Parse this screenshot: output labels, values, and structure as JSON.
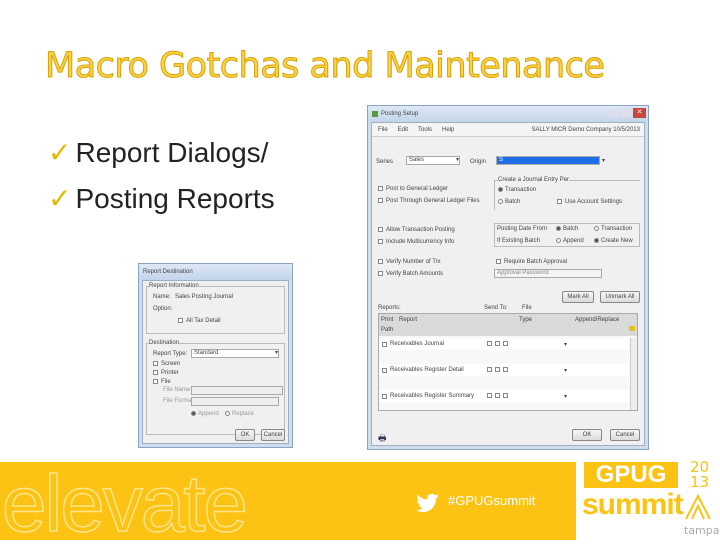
{
  "slide": {
    "title": "Macro Gotchas and Maintenance",
    "bullets": [
      "Report Dialogs/",
      "Posting Reports"
    ],
    "hashtag": "#GPUGsummit",
    "brand_word": "elevate",
    "logo": {
      "line1": "GPUG",
      "line2": "summit",
      "year_top": "20",
      "year_bottom": "13",
      "city": "tampa"
    }
  },
  "posting_setup": {
    "title": "Posting Setup",
    "menu": [
      "File",
      "Edit",
      "Tools",
      "Help"
    ],
    "company": "SALLY  MICR Demo Company  10/5/2013",
    "series_label": "Series",
    "series_value": "Sales",
    "origin_label": "Origin",
    "origin_value": "S",
    "checks": [
      "Post to General Ledger",
      "Post Through General Ledger Files",
      "Allow Transaction Posting",
      "Include Multicurrency Info",
      "Verify Number of Trx",
      "Verify Batch Amounts"
    ],
    "create_group": "Create a Journal Entry Per",
    "create_opts": [
      "Transaction",
      "Batch",
      "Use Account Settings"
    ],
    "posting_date_from": "Posting Date From",
    "posting_date_opts": [
      "Batch",
      "Transaction"
    ],
    "if_existing": "If Existing Batch",
    "existing_opts": [
      "Append",
      "Create New"
    ],
    "require_approval": "Require Batch Approval",
    "approval_password": "Approval Password",
    "mark_all": "Mark All",
    "unmark_all": "Unmark All",
    "reports_label": "Reports:",
    "send_to": "Send To:",
    "file_label": "File",
    "cols": [
      "Print",
      "Report",
      "Type",
      "Append/Replace"
    ],
    "path": "Path",
    "reports": [
      "Receivables Journal",
      "Receivables Register Detail",
      "Receivables Register Summary"
    ],
    "ok": "OK",
    "cancel": "Cancel"
  },
  "report_destination": {
    "title": "Report Destination",
    "info_group": "Report Information",
    "name_label": "Name:",
    "name_value": "Sales Posting Journal",
    "option_label": "Option:",
    "option_value": "All Tax Detail",
    "dest_group": "Destination",
    "report_type_label": "Report Type:",
    "report_type_value": "Standard",
    "checks": [
      "Screen",
      "Printer",
      "File"
    ],
    "file_name": "File Name:",
    "file_format": "File Format:",
    "radios": [
      "Append",
      "Replace"
    ],
    "ok": "OK",
    "cancel": "Cancel"
  },
  "colors": {
    "accent": "#fcc214",
    "title": "#fbd04a"
  }
}
